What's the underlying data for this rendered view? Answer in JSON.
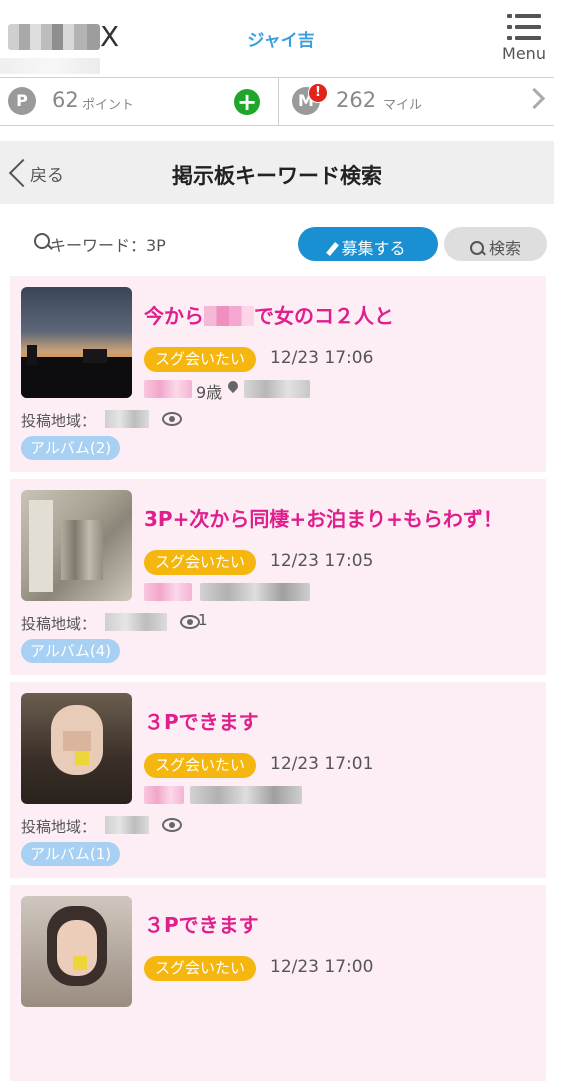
{
  "header": {
    "user_name": "ジャイ吉",
    "menu_label": "Menu"
  },
  "points": {
    "point_coin": "P",
    "point_value": "62",
    "point_unit": "ポイント",
    "add_symbol": "+",
    "mile_coin": "M",
    "mile_alert": "!",
    "mile_value": "262",
    "mile_unit": "マイル"
  },
  "title_bar": {
    "back_label": "戻る",
    "title": "掲示板キーワード検索"
  },
  "search": {
    "keyword_text": "キーワード：3P",
    "recruit_label": "募集する",
    "search_label": "検索"
  },
  "posts": [
    {
      "title_before": "今から",
      "title_after": "で女のコ２人と",
      "tag": "スグ会いたい",
      "time": "12/23 17:06",
      "age": "9歳",
      "area_label": "投稿地域：",
      "view_count": "",
      "album": "アルバム(2)"
    },
    {
      "title": "3P+次から同棲+お泊まり+もらわず！",
      "tag": "スグ会いたい",
      "time": "12/23 17:05",
      "area_label": "投稿地域：",
      "view_count": "1",
      "album": "アルバム(4)"
    },
    {
      "title": "３Pできます",
      "tag": "スグ会いたい",
      "time": "12/23 17:01",
      "area_label": "投稿地域：",
      "view_count": "",
      "album": "アルバム(1)"
    },
    {
      "title": "３Pできます",
      "tag": "スグ会いたい",
      "time": "12/23 17:00"
    }
  ],
  "colors": {
    "accent_blue": "#1a8fd1",
    "title_pink": "#e01f8c",
    "tag_yellow": "#f5b70f",
    "post_bg": "#fdeef6",
    "album_blue": "#a8d0f2"
  }
}
